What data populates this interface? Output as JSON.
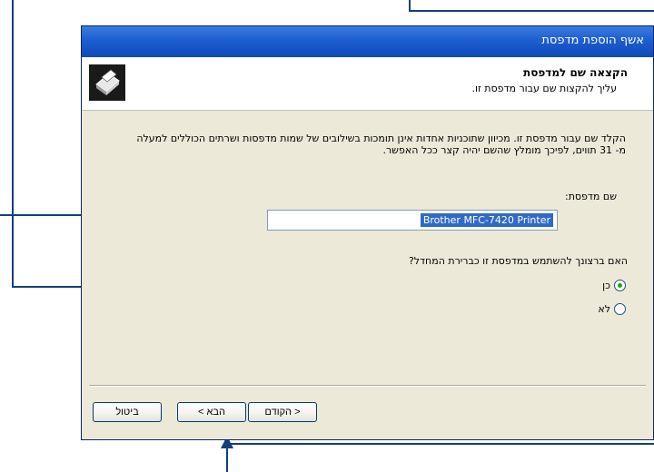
{
  "window": {
    "title": "אשף הוספת מדפסת"
  },
  "header": {
    "title": "הקצאה שם למדפסת",
    "subtitle": "עליך להקצות שם עבור מדפסת זו.",
    "icon": "printer-icon"
  },
  "body": {
    "description": "הקלד שם עבור מדפסת זו. מכיוון שתוכניות אחדות אינן תומכות בשילובים של שמות מדפסות ושרתים הכוללים למעלה מ- 31 תווים, לפיכך מומלץ שהשם יהיה קצר ככל האפשר.",
    "printer_name_label": "שם מדפסת:",
    "printer_name_value": "Brother MFC-7420 Printer",
    "default_question": "האם ברצונך להשתמש במדפסת זו כברירת המחדל?",
    "options": [
      "כן",
      "לא"
    ],
    "selected_option": "כן"
  },
  "buttons": {
    "back": "< הקודם",
    "next": "הבא >",
    "cancel": "ביטול"
  },
  "colors": {
    "callout": "#123f7a",
    "title_bar": "#1d5ecf",
    "selection": "#316ac5"
  }
}
